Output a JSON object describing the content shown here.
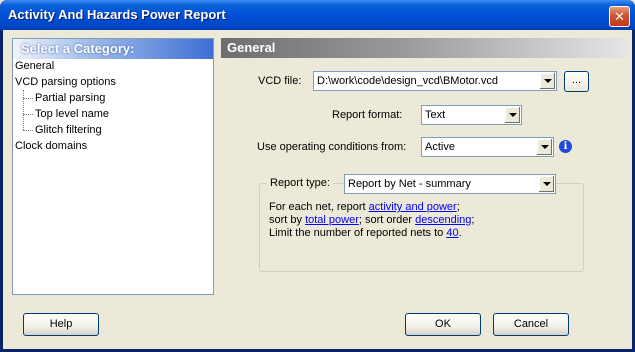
{
  "window": {
    "title": "Activity And Hazards Power Report",
    "close_glyph": "✕"
  },
  "category_panel": {
    "header": "Select a Category:",
    "items": [
      {
        "label": "General",
        "level": 0
      },
      {
        "label": "VCD parsing options",
        "level": 0
      },
      {
        "label": "Partial parsing",
        "level": 1
      },
      {
        "label": "Top level name",
        "level": 1
      },
      {
        "label": "Glitch filtering",
        "level": 1
      },
      {
        "label": "Clock domains",
        "level": 0
      }
    ]
  },
  "general": {
    "header": "General",
    "vcd_file_label": "VCD file:",
    "vcd_file_value": "D:\\work\\code\\design_vcd\\BMotor.vcd",
    "browse_label": "...",
    "report_format_label": "Report format:",
    "report_format_value": "Text",
    "operating_conditions_label": "Use operating conditions from:",
    "operating_conditions_value": "Active",
    "info_glyph": "i",
    "report_type_label": "Report type:",
    "report_type_value": "Report by Net - summary",
    "description": {
      "line1_prefix": "For each net, report ",
      "line1_link": "activity and power",
      "line1_suffix": ";",
      "line2_prefix": "sort by ",
      "line2_link1": "total power",
      "line2_middle": "; sort order ",
      "line2_link2": "descending",
      "line2_suffix": ";",
      "line3_prefix": "Limit the number of reported nets to ",
      "line3_link": "40",
      "line3_suffix": "."
    }
  },
  "buttons": {
    "help": "Help",
    "ok": "OK",
    "cancel": "Cancel"
  },
  "colors": {
    "title_bar": "#0050d8",
    "link": "#0000ff",
    "dialog_bg": "#ece9d8"
  }
}
